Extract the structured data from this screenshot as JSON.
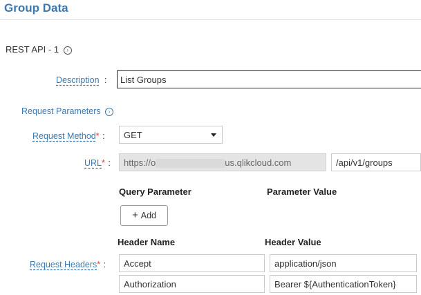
{
  "page": {
    "title": "Group Data"
  },
  "section": {
    "title": "REST API - 1",
    "toggle_icon": "circle-chevron-right-icon"
  },
  "description": {
    "label": "Description",
    "colon": ":",
    "value": "List Groups"
  },
  "request_parameters": {
    "title": "Request Parameters",
    "toggle_icon": "circle-chevron-right-icon"
  },
  "request_method": {
    "label": "Request Method",
    "required": "*",
    "colon": ":",
    "value": "GET"
  },
  "url": {
    "label": "URL",
    "required": "*",
    "colon": ":",
    "base_prefix": "https://o",
    "base_suffix": "us.qlikcloud.com",
    "path": "/api/v1/groups"
  },
  "query_params": {
    "param_header": "Query Parameter",
    "value_header": "Parameter Value",
    "add_icon": "+",
    "add_label": "Add"
  },
  "headers": {
    "label": "Request Headers",
    "required": "*",
    "colon": ":",
    "name_header": "Header Name",
    "value_header": "Header Value",
    "rows": [
      {
        "name": "Accept",
        "value": "application/json"
      },
      {
        "name": "Authorization",
        "value": "Bearer ${AuthenticationToken}"
      }
    ]
  },
  "colors": {
    "accent": "#3d78ad",
    "required": "#d64545"
  }
}
